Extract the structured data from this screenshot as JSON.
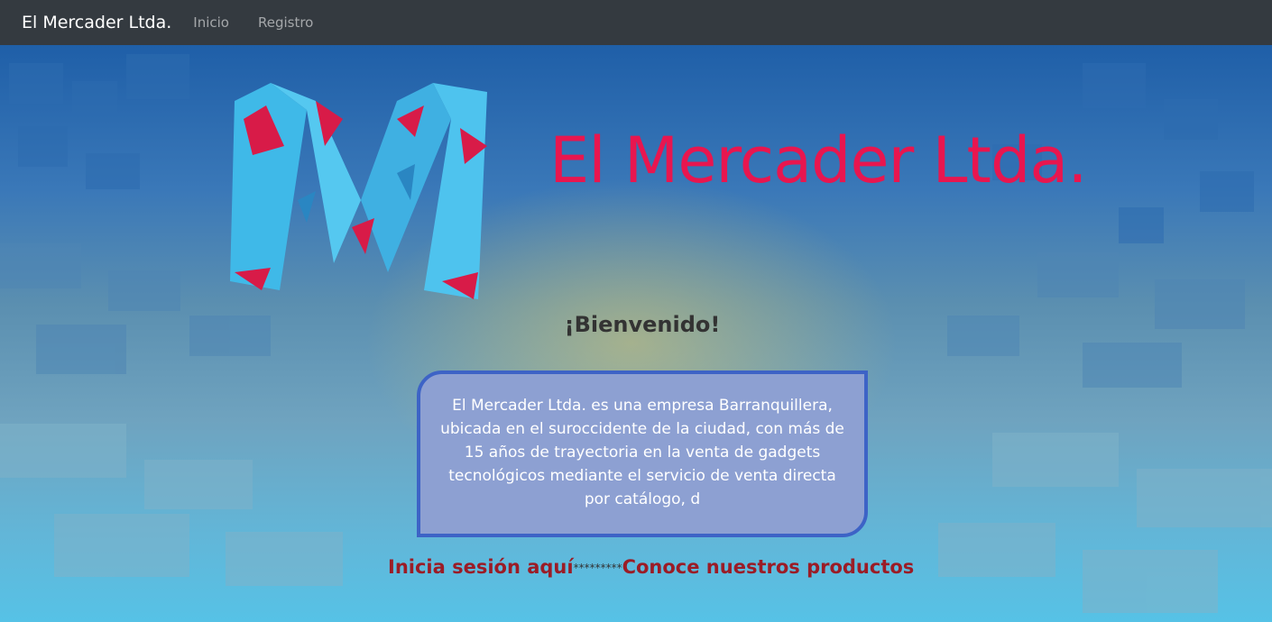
{
  "navbar": {
    "brand": "El Mercader Ltda.",
    "links": [
      "Inicio",
      "Registro"
    ]
  },
  "hero": {
    "title": "El Mercader Ltda.",
    "welcome": "¡Bienvenido!",
    "description": "El Mercader Ltda. es una empresa Barranquillera, ubicada en el suroccidente de la ciudad, con más de 15 años de trayectoria en la venta de gadgets tecnológicos mediante el servicio de venta directa por catálogo, d",
    "login_link": "Inicia sesión aquí",
    "separator": "*********",
    "products_link": "Conoce nuestros productos"
  },
  "colors": {
    "navbar_bg": "#343a40",
    "title": "#e8164f",
    "link": "#9b1c26",
    "card_bg": "#8da0d2",
    "card_border": "#3d63c6"
  },
  "icons": {
    "logo": "polygon-m-logo"
  }
}
